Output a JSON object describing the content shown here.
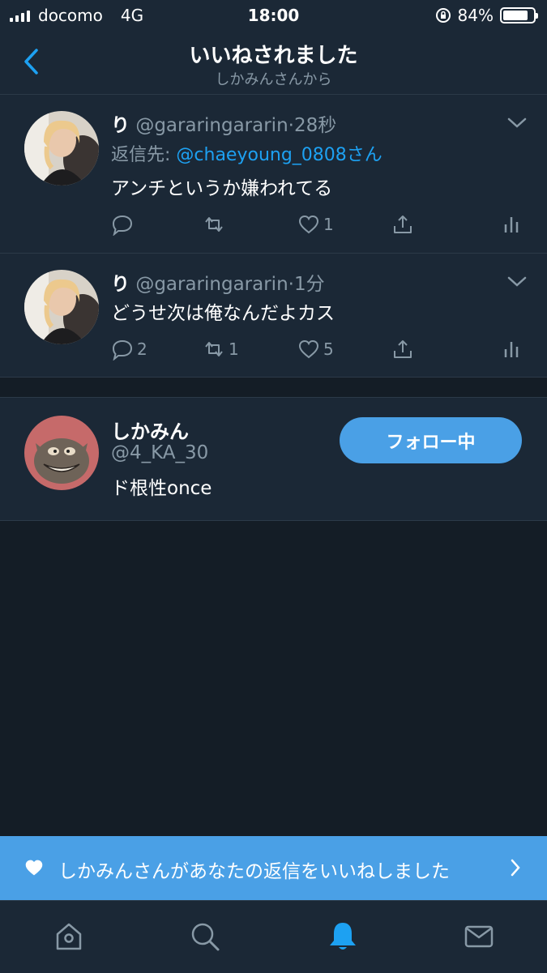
{
  "status_bar": {
    "carrier": "docomo",
    "network": "4G",
    "time": "18:00",
    "battery_percent": "84%",
    "battery_level": 0.84
  },
  "header": {
    "title": "いいねされました",
    "subtitle": "しかみんさんから"
  },
  "tweets": [
    {
      "name": "り",
      "handle": "@gararingararin",
      "dot": "·",
      "time": "28秒",
      "reply_prefix": "返信先: ",
      "reply_to": "@chaeyoung_0808さん",
      "text": "アンチというか嫌われてる",
      "replies": "",
      "retweets": "",
      "likes": "1"
    },
    {
      "name": "り",
      "handle": "@gararingararin",
      "dot": "·",
      "time": "1分",
      "text": "どうせ次は俺なんだよカス",
      "replies": "2",
      "retweets": "1",
      "likes": "5"
    }
  ],
  "user": {
    "name": "しかみん",
    "handle": "@4_KA_30",
    "bio": "ド根性once",
    "follow_label": "フォロー中"
  },
  "toast": {
    "text": "しかみんさんがあなたの返信をいいねしました"
  },
  "tabs": [
    "home-icon",
    "search-icon",
    "notifications-icon",
    "messages-icon"
  ],
  "colors": {
    "accent": "#4aa0e6",
    "link": "#1da1f2",
    "background": "#141d26",
    "card": "#1b2836",
    "muted": "#8899a6"
  }
}
